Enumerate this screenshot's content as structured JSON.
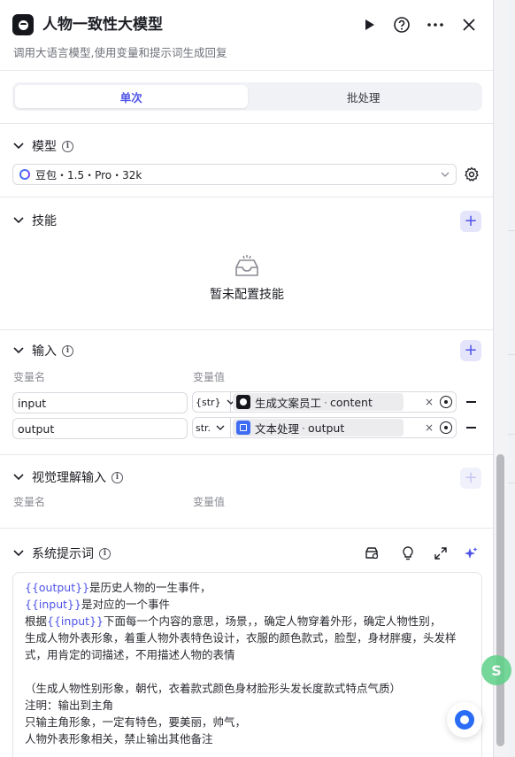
{
  "header": {
    "title": "人物一致性大模型",
    "subtitle": "调用大语言模型,使用变量和提示词生成回复",
    "icons": [
      "run-icon",
      "help-icon",
      "more-icon",
      "close-icon"
    ]
  },
  "tabs": [
    {
      "label": "单次",
      "active": true
    },
    {
      "label": "批处理",
      "active": false
    }
  ],
  "model_section": {
    "title": "模型",
    "selected_model": "豆包・1.5・Pro・32k"
  },
  "skill_section": {
    "title": "技能",
    "empty_text": "暂未配置技能"
  },
  "input_section": {
    "title": "输入",
    "col_name": "变量名",
    "col_value": "变量值",
    "rows": [
      {
        "name": "input",
        "type": "{str}",
        "source": "生成文案员工",
        "field": "content",
        "source_icon": "robot-icon"
      },
      {
        "name": "output",
        "type": "str.",
        "source": "文本处理",
        "field": "output",
        "source_icon": "text-process-icon"
      }
    ]
  },
  "vision_section": {
    "title": "视觉理解输入",
    "col_name": "变量名",
    "col_value": "变量值"
  },
  "prompt_section": {
    "title": "系统提示词",
    "lines": [
      {
        "var": "{{output}}",
        "text": "是历史人物的一生事件，"
      },
      {
        "var": "{{input}}",
        "text": "是对应的一个事件"
      },
      {
        "prefix": "根据",
        "var": "{{input}}",
        "text": "下面每一个内容的意思，场景，，确定人物穿着外形，确定人物性别，"
      },
      {
        "text": "生成人物外表形象，着重人物外表特色设计，衣服的颜色款式，脸型，身材胖瘦，头发样"
      },
      {
        "text": "式，用肯定的词描述，不用描述人物的表情"
      },
      {
        "text": ""
      },
      {
        "text": "（生成人物性别形象，朝代，衣着款式颜色身材脸形头发长度款式特点气质）"
      },
      {
        "text": "注明：输出到主角"
      },
      {
        "text": "只输主角形象，一定有特色，要美丽，帅气，"
      },
      {
        "text": "人物外表形象相关，禁止输出其他备注"
      }
    ]
  },
  "colors": {
    "accent": "#4d53e8",
    "text": "#1c1d23",
    "muted": "#8a8b93"
  }
}
